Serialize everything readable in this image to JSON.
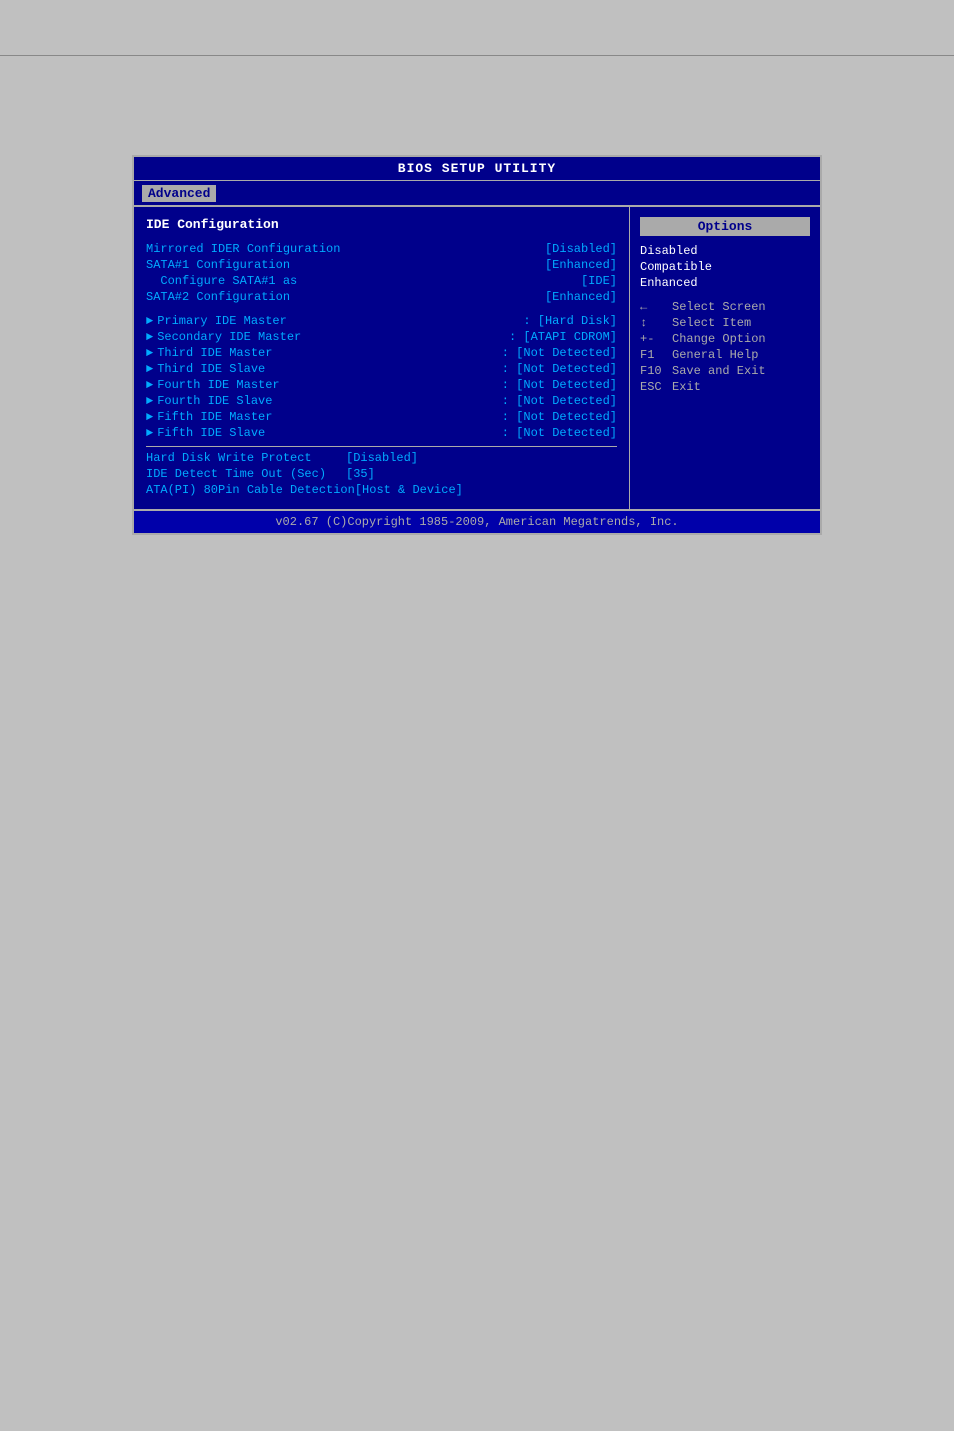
{
  "title": "BIOS SETUP UTILITY",
  "menu": {
    "active_tab": "Advanced"
  },
  "left_panel": {
    "section_title": "IDE Configuration",
    "config_rows": [
      {
        "label": "Mirrored IDER Configuration",
        "value": "[Disabled]"
      },
      {
        "label": "SATA#1 Configuration",
        "value": "[Enhanced]"
      },
      {
        "label": "  Configure SATA#1 as",
        "value": "[IDE]"
      },
      {
        "label": "SATA#2 Configuration",
        "value": "[Enhanced]"
      }
    ],
    "ide_rows": [
      {
        "label": "Primary IDE Master",
        "value": ": [Hard Disk]"
      },
      {
        "label": "Secondary IDE Master",
        "value": ": [ATAPI CDROM]"
      },
      {
        "label": "Third IDE Master",
        "value": ": [Not Detected]"
      },
      {
        "label": "Third IDE Slave",
        "value": ": [Not Detected]"
      },
      {
        "label": "Fourth IDE Master",
        "value": ": [Not Detected]"
      },
      {
        "label": "Fourth IDE Slave",
        "value": ": [Not Detected]"
      },
      {
        "label": "Fifth IDE Master",
        "value": ": [Not Detected]"
      },
      {
        "label": "Fifth IDE Slave",
        "value": ": [Not Detected]"
      }
    ],
    "bottom_rows": [
      {
        "label": "Hard Disk Write Protect",
        "value": "[Disabled]"
      },
      {
        "label": "IDE Detect Time Out (Sec)",
        "value": "[35]"
      },
      {
        "label": "ATA(PI) 80Pin Cable Detection",
        "value": "[Host & Device]"
      }
    ]
  },
  "right_panel": {
    "options_title": "Options",
    "options": [
      "Disabled",
      "Compatible",
      "Enhanced"
    ],
    "keybinds": [
      {
        "key": "←",
        "action": "Select Screen"
      },
      {
        "key": "↑↓",
        "action": "Select Item"
      },
      {
        "key": "+-",
        "action": "Change Option"
      },
      {
        "key": "F1",
        "action": "General Help"
      },
      {
        "key": "F10",
        "action": "Save and Exit"
      },
      {
        "key": "ESC",
        "action": "Exit"
      }
    ]
  },
  "footer": "v02.67 (C)Copyright 1985-2009, American Megatrends, Inc."
}
